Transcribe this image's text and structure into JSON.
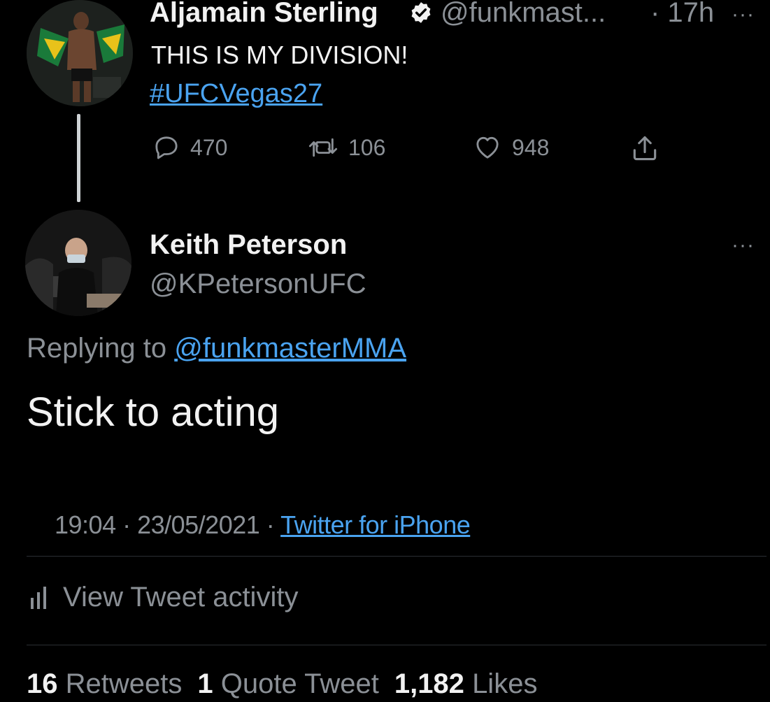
{
  "parent_tweet": {
    "author_name": "Aljamain Sterling",
    "handle": "@funkmast...",
    "time": "· 17h",
    "more": "···",
    "text": "THIS IS MY DIVISION!",
    "hashtag": "#UFCVegas27",
    "replies": "470",
    "retweets": "106",
    "likes": "948"
  },
  "main_tweet": {
    "author_name": "Keith Peterson",
    "handle": "@KPetersonUFC",
    "more": "···",
    "replying_prefix": "Replying to",
    "replying_to": "@funkmasterMMA",
    "text": "Stick to acting",
    "timestamp": "19:04 · 23/05/2021 · ",
    "source": "Twitter for iPhone",
    "activity_label": "View Tweet activity",
    "stats": {
      "retweets_count": "16",
      "retweets_label": "Retweets",
      "quotes_count": "1",
      "quotes_label": "Quote Tweet",
      "likes_count": "1,182",
      "likes_label": "Likes"
    }
  },
  "colors": {
    "background": "#000000",
    "link": "#4aa3f0",
    "secondary_text": "#8b9096"
  }
}
